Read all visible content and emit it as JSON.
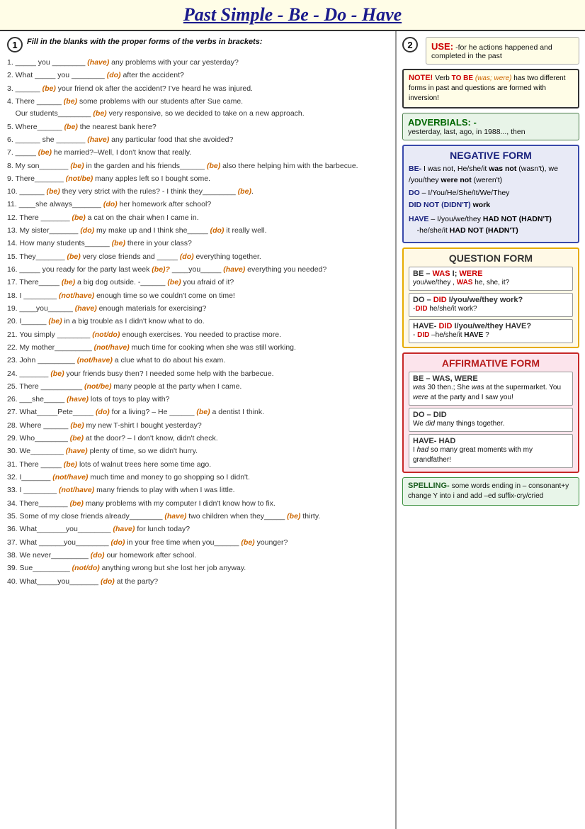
{
  "title": "Past Simple - Be - Do - Have",
  "section1": {
    "num": "1",
    "instruction": "Fill in the blanks with the proper forms of the verbs in brackets:",
    "exercises": [
      {
        "num": "1.",
        "text": "_____ you ________ ",
        "verb": "(have)",
        "text2": " any problems with your car yesterday?"
      },
      {
        "num": "2.",
        "text": "What _____ you ________ ",
        "verb": "(do)",
        "text2": " after the accident?"
      },
      {
        "num": "3.",
        "text": "______ ",
        "verb": "(be)",
        "text2": " your friend ok after the accident?  I've heard he was injured."
      },
      {
        "num": "4.",
        "text": "There ______ ",
        "verb": "(be)",
        "text2": " some problems with our students after Sue came. Our students________ ",
        "verb2": "(be)",
        "text3": " very responsive, so we decided to take on a new approach."
      },
      {
        "num": "5.",
        "text": "Where______ ",
        "verb": "(be)",
        "text2": " the nearest bank here?"
      },
      {
        "num": "6.",
        "text": "______ she _______ ",
        "verb": "(have)",
        "text2": " any particular food that she avoided?"
      },
      {
        "num": "7.",
        "text": "_____ ",
        "verb": "(be)",
        "text2": " he married?–Well, I don't know that really."
      },
      {
        "num": "8.",
        "text": "My son_______ ",
        "verb": "(be)",
        "text2": " in the garden and his friends______ ",
        "verb2": "(be)",
        "text3": " also there helping him with the barbecue."
      },
      {
        "num": "9.",
        "text": "There_______ ",
        "verb": "(not/be)",
        "text2": " many apples left so I bought some."
      },
      {
        "num": "10.",
        "text": "______ ",
        "verb": "(be)",
        "text2": " they very strict with the rules? - I think they________ ",
        "verb2": "(be)",
        "text3": "."
      },
      {
        "num": "11.",
        "text": "____she always_______ ",
        "verb": "(do)",
        "text2": " her homework after school?"
      },
      {
        "num": "12.",
        "text": "There _______ ",
        "verb": "(be)",
        "text2": " a cat on the chair when I came in."
      },
      {
        "num": "13.",
        "text": "My sister_______ ",
        "verb": "(do)",
        "text2": " my make up and I think she_____ ",
        "verb2": "(do)",
        "text3": " it really well."
      },
      {
        "num": "14.",
        "text": "How many students______ ",
        "verb": "(be)",
        "text2": " there in your class?"
      },
      {
        "num": "15.",
        "text": "They_______ ",
        "verb": "(be)",
        "text2": " very close friends and _____ ",
        "verb2": "(do)",
        "text3": " everything together."
      },
      {
        "num": "16.",
        "text": "_____ you ready for the party last week ",
        "verb": "(be)?",
        "text2": " ____you_____ ",
        "verb2": "(have)",
        "text3": " everything you needed?"
      },
      {
        "num": "17.",
        "text": "There_____ ",
        "verb": "(be)",
        "text2": " a big dog outside. -______ ",
        "verb2": "(be)",
        "text3": " you afraid of it?"
      },
      {
        "num": "18.",
        "text": "I ________ ",
        "verb": "(not/have)",
        "text2": " enough time so we couldn't come on time!"
      },
      {
        "num": "19.",
        "text": "____you______ ",
        "verb": "(have)",
        "text2": " enough materials for exercising?"
      },
      {
        "num": "20.",
        "text": "I______ ",
        "verb": "(be)",
        "text2": " in a big trouble as I didn't know what to do."
      },
      {
        "num": "21.",
        "text": "You simply ________ ",
        "verb": "(not/do)",
        "text2": " enough exercises. You needed to practise more."
      },
      {
        "num": "22.",
        "text": "My mother_________ ",
        "verb": "(not/have)",
        "text2": " much time for cooking when she was still working."
      },
      {
        "num": "23.",
        "text": "John _________ ",
        "verb": "(not/have)",
        "text2": " a clue what to do about his exam."
      },
      {
        "num": "24.",
        "text": "_______ ",
        "verb": "(be)",
        "text2": " your friends busy then? I needed some help with the barbecue."
      },
      {
        "num": "25.",
        "text": "There __________ ",
        "verb": "(not/be)",
        "text2": " many people at the party when I came."
      },
      {
        "num": "26.",
        "text": "___she_____ ",
        "verb": "(have)",
        "text2": " lots of toys to play with?"
      },
      {
        "num": "27.",
        "text": "What_____Pete_____ ",
        "verb": "(do)",
        "text2": " for a living? – He ______ ",
        "verb2": "(be)",
        "text3": " a dentist I think."
      },
      {
        "num": "28.",
        "text": "Where ______ ",
        "verb": "(be)",
        "text2": " my new T-shirt I bought yesterday?"
      },
      {
        "num": "29.",
        "text": "Who________ ",
        "verb": "(be)",
        "text2": " at the door? – I don't know, didn't check."
      },
      {
        "num": "30.",
        "text": "We________ ",
        "verb": "(have)",
        "text2": " plenty of time, so we didn't hurry."
      },
      {
        "num": "31.",
        "text": "There _____ ",
        "verb": "(be)",
        "text2": " lots of walnut trees here some time ago."
      },
      {
        "num": "32.",
        "text": "I_______ ",
        "verb": "(not/have)",
        "text2": " much time and money to go shopping so I didn't."
      },
      {
        "num": "33.",
        "text": "I ________ ",
        "verb": "(not/have)",
        "text2": " many friends to play with when I was little."
      },
      {
        "num": "34.",
        "text": "There_______ ",
        "verb": "(be)",
        "text2": " many problems with my computer I didn't know how to fix."
      },
      {
        "num": "35.",
        "text": "Some of my close friends already________ ",
        "verb": "(have)",
        "text2": " two children when they_____ ",
        "verb2": "(be)",
        "text3": " thirty."
      },
      {
        "num": "36.",
        "text": "What_______you________ ",
        "verb": "(have)",
        "text2": " for lunch today?"
      },
      {
        "num": "37.",
        "text": "What ______you________ ",
        "verb": "(do)",
        "text2": " in your free time when you______ ",
        "verb2": "(be)",
        "text3": " younger?"
      },
      {
        "num": "38.",
        "text": "We never_________ ",
        "verb": "(do)",
        "text2": " our homework after school."
      },
      {
        "num": "39.",
        "text": "Sue_________ ",
        "verb": "(not/do)",
        "text2": " anything wrong but she lost her job anyway."
      },
      {
        "num": "40.",
        "text": "What_____you_______ ",
        "verb": "(do)",
        "text2": " at the party?"
      }
    ]
  },
  "section2": {
    "num": "2",
    "use": {
      "title": "USE:",
      "text": " -for he actions happened and completed in the past"
    },
    "note": {
      "title": "NOTE!",
      "text": " Verb TO BE ",
      "italic": "(was; were)",
      "text2": " has two different forms in past and questions are formed with inversion!"
    },
    "adverbials": {
      "title": "ADVERBIALS: -",
      "text": "yesterday, last, ago, in 1988..., then"
    },
    "negative_form": {
      "title": "NEGATIVE FORM",
      "lines": [
        {
          "text": "BE- I was not, He/she/it ",
          "bold": "was not",
          "text2": " (wasn't), we /you/they ",
          "bold2": "were not",
          "text3": " (weren't)"
        },
        {
          "text": "DO – I/You/He/She/It/We/They"
        },
        {
          "text": "DID NOT (DIDN'T) ",
          "bold": "work"
        }
      ],
      "have_line": "HAVE – I/you/we/they HAD NOT (HADN'T) -he/she/it HAD NOT (HADN'T)"
    },
    "question_form": {
      "title": "QUESTION FORM",
      "lines": [
        {
          "text": "BE – WAS I; WERE you/we/they , WAS he, she, it?"
        },
        {
          "text": "DO – DID I/you/we/they work? -DID he/she/it work?"
        },
        {
          "text": "HAVE- DID I/you/we/they HAVE? - DID –he/she/it HAVE ?"
        }
      ]
    },
    "affirmative_form": {
      "title": "AFFIRMATIVE FORM",
      "boxes": [
        {
          "title": "BE – WAS, WERE",
          "text": "was 30 then.; She was at the supermarket. You were at the party and I saw you!"
        },
        {
          "title": "DO – DID",
          "text": "We did many things together."
        },
        {
          "title": "HAVE- HAD",
          "text": "I had so many great moments with my grandfather!"
        }
      ]
    },
    "spelling": {
      "title": "SPELLING-",
      "text": " some words ending in – consonant+y change Y into i and add –ed suffix-cry/cried"
    }
  }
}
